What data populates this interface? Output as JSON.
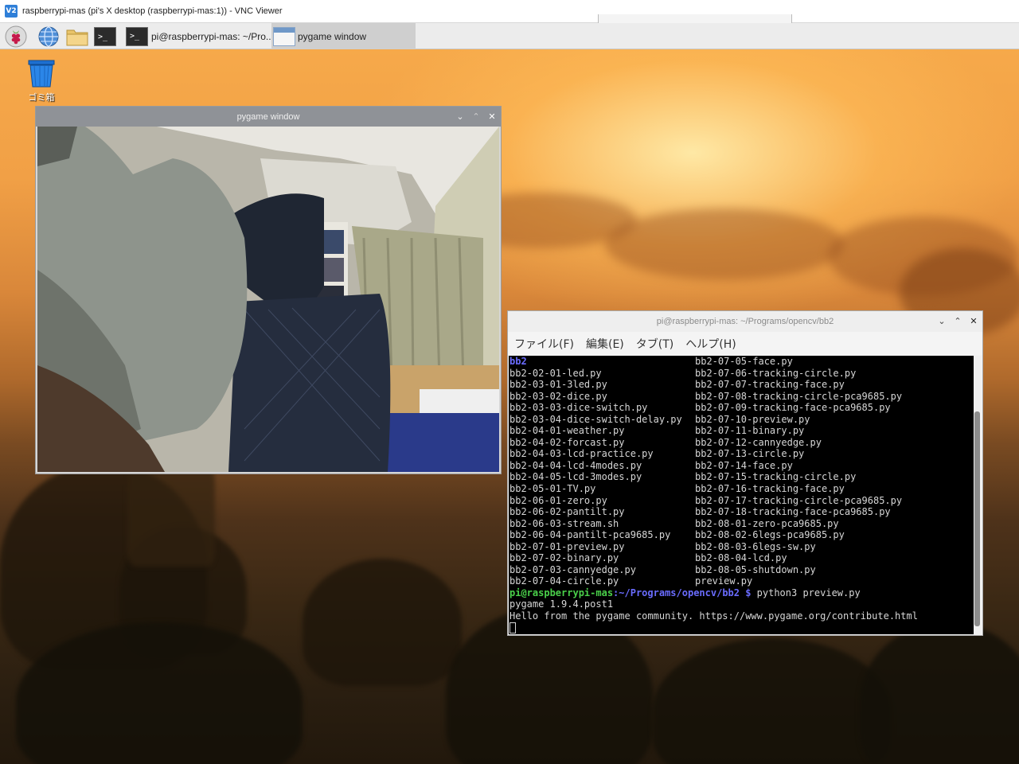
{
  "vnc": {
    "logo": "V2",
    "title": "raspberrypi-mas (pi's X desktop (raspberrypi-mas:1)) - VNC Viewer"
  },
  "taskbar": {
    "apps": [
      {
        "icon": "terminal-icon",
        "label": "pi@raspberrypi-mas: ~/Pro..."
      },
      {
        "icon": "window-icon",
        "label": "pygame window"
      }
    ],
    "terminal_glyph": ">_"
  },
  "desktop": {
    "trash_label": "ゴミ箱"
  },
  "pygame_window": {
    "title": "pygame window",
    "controls": {
      "minimize": "⌄",
      "maximize": "⌃",
      "close": "✕"
    }
  },
  "terminal": {
    "title": "pi@raspberrypi-mas: ~/Programs/opencv/bb2",
    "menus": [
      "ファイル(F)",
      "編集(E)",
      "タブ(T)",
      "ヘルプ(H)"
    ],
    "controls": {
      "minimize": "⌄",
      "maximize": "⌃",
      "close": "✕"
    },
    "listing": [
      [
        "bb2",
        "bb2-07-05-face.py"
      ],
      [
        "bb2-02-01-led.py",
        "bb2-07-06-tracking-circle.py"
      ],
      [
        "bb2-03-01-3led.py",
        "bb2-07-07-tracking-face.py"
      ],
      [
        "bb2-03-02-dice.py",
        "bb2-07-08-tracking-circle-pca9685.py"
      ],
      [
        "bb2-03-03-dice-switch.py",
        "bb2-07-09-tracking-face-pca9685.py"
      ],
      [
        "bb2-03-04-dice-switch-delay.py",
        "bb2-07-10-preview.py"
      ],
      [
        "bb2-04-01-weather.py",
        "bb2-07-11-binary.py"
      ],
      [
        "bb2-04-02-forcast.py",
        "bb2-07-12-cannyedge.py"
      ],
      [
        "bb2-04-03-lcd-practice.py",
        "bb2-07-13-circle.py"
      ],
      [
        "bb2-04-04-lcd-4modes.py",
        "bb2-07-14-face.py"
      ],
      [
        "bb2-04-05-lcd-3modes.py",
        "bb2-07-15-tracking-circle.py"
      ],
      [
        "bb2-05-01-TV.py",
        "bb2-07-16-tracking-face.py"
      ],
      [
        "bb2-06-01-zero.py",
        "bb2-07-17-tracking-circle-pca9685.py"
      ],
      [
        "bb2-06-02-pantilt.py",
        "bb2-07-18-tracking-face-pca9685.py"
      ],
      [
        "bb2-06-03-stream.sh",
        "bb2-08-01-zero-pca9685.py"
      ],
      [
        "bb2-06-04-pantilt-pca9685.py",
        "bb2-08-02-6legs-pca9685.py"
      ],
      [
        "bb2-07-01-preview.py",
        "bb2-08-03-6legs-sw.py"
      ],
      [
        "bb2-07-02-binary.py",
        "bb2-08-04-lcd.py"
      ],
      [
        "bb2-07-03-cannyedge.py",
        "bb2-08-05-shutdown.py"
      ],
      [
        "bb2-07-04-circle.py",
        "preview.py"
      ]
    ],
    "prompt_user": "pi@raspberrypi-mas",
    "prompt_path": ":~/Programs/opencv/bb2 $",
    "command": " python3 preview.py",
    "output": [
      "pygame 1.9.4.post1",
      "Hello from the pygame community. https://www.pygame.org/contribute.html"
    ]
  }
}
